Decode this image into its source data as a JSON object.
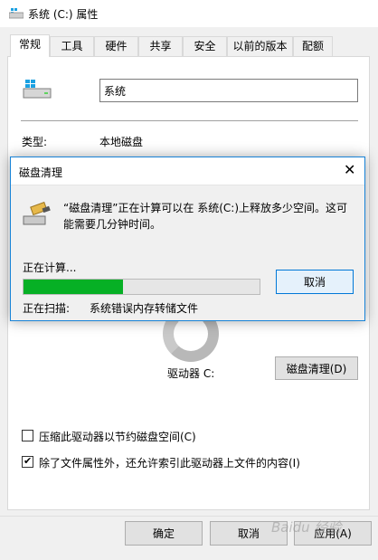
{
  "window": {
    "title": "系统 (C:) 属性"
  },
  "tabs": [
    {
      "label": "常规",
      "active": true
    },
    {
      "label": "工具",
      "active": false
    },
    {
      "label": "硬件",
      "active": false
    },
    {
      "label": "共享",
      "active": false
    },
    {
      "label": "安全",
      "active": false
    },
    {
      "label": "以前的版本",
      "active": false
    },
    {
      "label": "配额",
      "active": false
    }
  ],
  "general": {
    "drive_name_value": "系统",
    "type_label": "类型:",
    "type_value": "本地磁盘",
    "drive_label": "驱动器 C:",
    "cleanup_button": "磁盘清理(D)",
    "compress_label": "压缩此驱动器以节约磁盘空间(C)",
    "compress_checked": false,
    "index_label": "除了文件属性外，还允许索引此驱动器上文件的内容(I)",
    "index_checked": true
  },
  "buttons": {
    "ok": "确定",
    "cancel": "取消",
    "apply": "应用(A)"
  },
  "dialog": {
    "title": "磁盘清理",
    "close_glyph": "✕",
    "message": "“磁盘清理”正在计算可以在 系统(C:)上释放多少空间。这可能需要几分钟时间。",
    "status": "正在计算...",
    "progress_fraction": 0.42,
    "progress_color": "#06b025",
    "cancel_button": "取消",
    "scanning_label": "正在扫描:",
    "scanning_value": "系统错误内存转储文件"
  },
  "watermark": "Baidu 经验"
}
